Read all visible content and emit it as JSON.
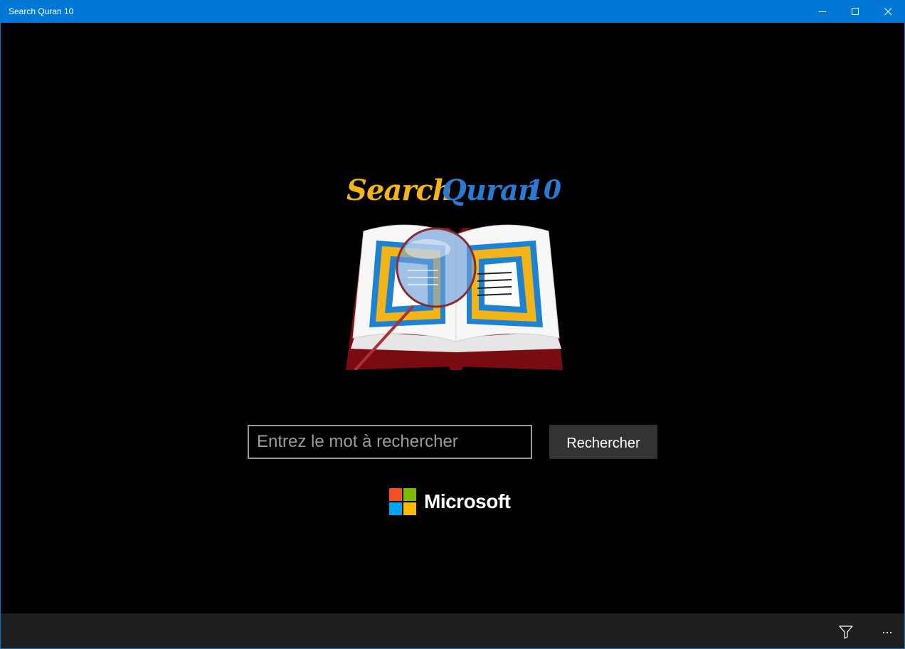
{
  "window": {
    "title": "Search Quran 10",
    "controls": {
      "minimize_icon": "minimize-icon",
      "maximize_icon": "maximize-icon",
      "close_icon": "close-icon"
    }
  },
  "logo": {
    "word1": "Search",
    "word2": "Quran",
    "word3": "10",
    "icon": "open-book-with-magnifier"
  },
  "search": {
    "placeholder": "Entrez le mot à rechercher",
    "value": "",
    "button_label": "Rechercher"
  },
  "brand": {
    "text": "Microsoft"
  },
  "appbar": {
    "filter_icon": "filter-icon",
    "more_label": "..."
  },
  "colors": {
    "titlebar": "#0078d7",
    "background": "#000000",
    "appbar": "#1f1f1f",
    "button": "#333333",
    "logo_gold": "#f2b417",
    "logo_blue": "#2a79d2"
  }
}
